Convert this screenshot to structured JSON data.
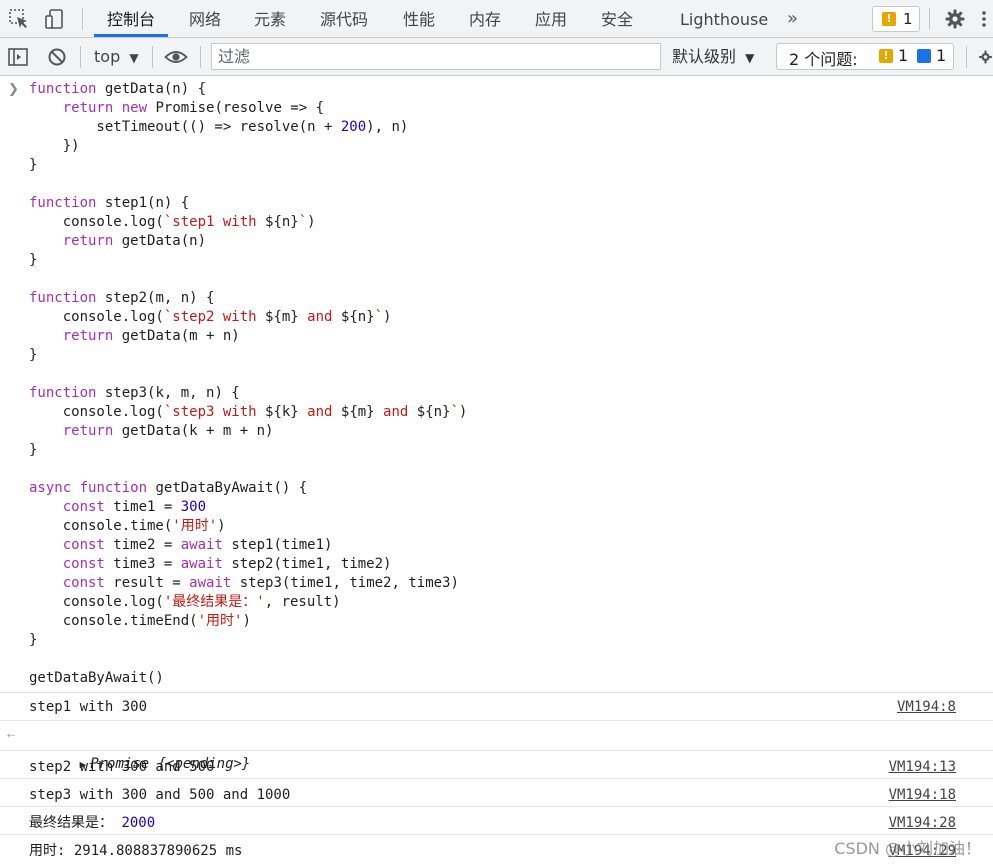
{
  "tabs": [
    {
      "label": "控制台",
      "active": true
    },
    {
      "label": "网络"
    },
    {
      "label": "元素"
    },
    {
      "label": "源代码"
    },
    {
      "label": "性能"
    },
    {
      "label": "内存"
    },
    {
      "label": "应用"
    },
    {
      "label": "安全"
    },
    {
      "label": "Lighthouse"
    }
  ],
  "more_tabs_icon": "»",
  "warning_badge_count": "1",
  "toolbar": {
    "context": "top",
    "filter_placeholder": "过滤",
    "levels": "默认级别",
    "issues_label": "2 个问题:",
    "issues_warning": "1",
    "issues_info": "1"
  },
  "console": {
    "code": [
      "function getData(n) {",
      "    return new Promise(resolve => {",
      "        setTimeout(() => resolve(n + 200), n)",
      "    })",
      "}",
      "",
      "function step1(n) {",
      "    console.log(`step1 with ${n}`)",
      "    return getData(n)",
      "}",
      "",
      "function step2(m, n) {",
      "    console.log(`step2 with ${m} and ${n}`)",
      "    return getData(m + n)",
      "}",
      "",
      "function step3(k, m, n) {",
      "    console.log(`step3 with ${k} and ${m} and ${n}`)",
      "    return getData(k + m + n)",
      "}",
      "",
      "async function getDataByAwait() {",
      "    const time1 = 300",
      "    console.time('用时')",
      "    const time2 = await step1(time1)",
      "    const time3 = await step2(time1, time2)",
      "    const result = await step3(time1, time2, time3)",
      "    console.log('最终结果是：', result)",
      "    console.timeEnd('用时')",
      "}",
      "",
      "getDataByAwait()"
    ],
    "messages": [
      {
        "text": "step1 with 300",
        "source": "VM194:8"
      },
      {
        "text": "Promise {<pending>}",
        "source": "",
        "is_return": true
      },
      {
        "text": "step2 with 300 and 500",
        "source": "VM194:13"
      },
      {
        "text": "step3 with 300 and 500 and 1000",
        "source": "VM194:18"
      },
      {
        "text_label": "最终结果是：",
        "text_value": "2000",
        "source": "VM194:28"
      },
      {
        "text": "用时: 2914.808837890625 ms",
        "source": "VM194:29"
      }
    ]
  },
  "watermark": "CSDN @小刘加油！",
  "colors": {
    "tab_active_underline": "#1a73e8",
    "keyword": "#a52fb5",
    "string": "#c41a16",
    "number": "#1c00cf",
    "warning": "#e8a600",
    "info": "#1a73e8"
  }
}
